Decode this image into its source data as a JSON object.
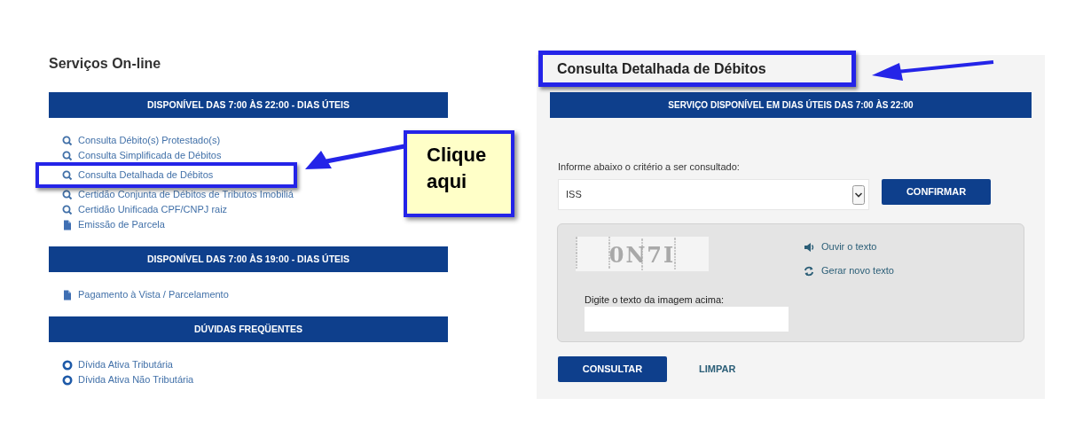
{
  "services": {
    "title": "Serviços On-line",
    "sections": [
      {
        "header": "DISPONÍVEL DAS 7:00 ÀS 22:00 - DIAS ÚTEIS",
        "items": [
          {
            "kind": "search",
            "label": "Consulta Débito(s) Protestado(s)",
            "highlighted": false
          },
          {
            "kind": "search",
            "label": "Consulta Simplificada de Débitos",
            "highlighted": false
          },
          {
            "kind": "search",
            "label": "Consulta Detalhada de Débitos",
            "highlighted": true
          },
          {
            "kind": "search",
            "label": "Certidão Conjunta de Débitos de Tributos Imobiliá",
            "highlighted": false
          },
          {
            "kind": "search",
            "label": "Certidão Unificada CPF/CNPJ raiz",
            "highlighted": false
          },
          {
            "kind": "document",
            "label": "Emissão de Parcela",
            "highlighted": false
          }
        ]
      },
      {
        "header": "DISPONÍVEL DAS 7:00 ÀS 19:00 - DIAS ÚTEIS",
        "items": [
          {
            "kind": "document",
            "label": "Pagamento à Vista / Parcelamento",
            "highlighted": false
          }
        ]
      },
      {
        "header": "DÚVIDAS FREQÜENTES",
        "items": [
          {
            "kind": "faq",
            "label": "Dívida Ativa Tributária",
            "highlighted": false
          },
          {
            "kind": "faq",
            "label": "Dívida Ativa Não Tributária",
            "highlighted": false
          }
        ]
      }
    ]
  },
  "callout": {
    "text": "Clique aqui"
  },
  "form": {
    "title": "Consulta Detalhada de Débitos",
    "title_highlighted": true,
    "banner": "SERVIÇO DISPONÍVEL EM DIAS ÚTEIS DAS 7:00 ÀS 22:00",
    "criteria_label": "Informe abaixo o critério a ser consultado:",
    "criteria_value": "ISS",
    "confirm_button": "CONFIRMAR",
    "captcha": {
      "image_text": "0N7I",
      "links": [
        {
          "kind": "audio",
          "label": "Ouvir o texto"
        },
        {
          "kind": "refresh",
          "label": "Gerar novo texto"
        }
      ],
      "input_label": "Digite o texto da imagem acima:"
    },
    "buttons": [
      {
        "label": "CONSULTAR",
        "kind": "primary"
      },
      {
        "label": "LIMPAR",
        "kind": "link"
      }
    ]
  }
}
